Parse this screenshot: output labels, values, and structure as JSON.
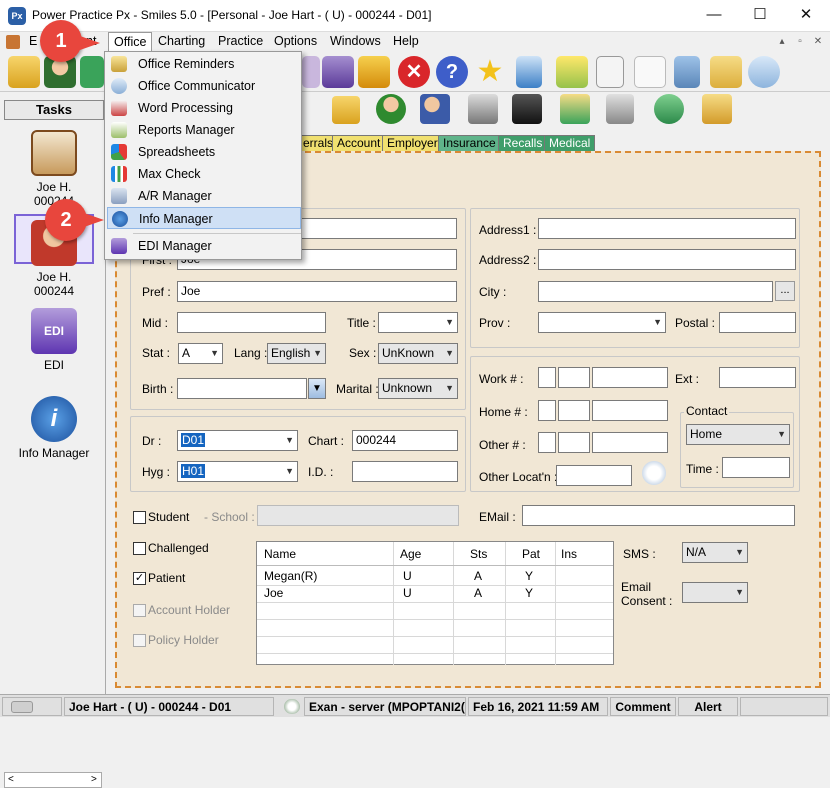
{
  "window": {
    "title": "Power Practice Px - Smiles 5.0 - [Personal - Joe Hart - ( U) - 000244 - D01]",
    "logo_text": "Px",
    "minimize": "—",
    "maximize": "☐",
    "close": "✕"
  },
  "menubar": {
    "partial_label": "E",
    "partial_label_end": "nt",
    "items": [
      "Office",
      "Charting",
      "Practice",
      "Options",
      "Windows",
      "Help"
    ],
    "mdi_controls": [
      "▴",
      "▫",
      "✕"
    ]
  },
  "office_menu": {
    "items": [
      {
        "label": "Office Reminders",
        "icon": "reminders-icon"
      },
      {
        "label": "Office Communicator",
        "icon": "communicator-icon"
      },
      {
        "label": "Word Processing",
        "icon": "word-processing-icon"
      },
      {
        "label": "Reports Manager",
        "icon": "reports-icon"
      },
      {
        "label": "Spreadsheets",
        "icon": "spreadsheet-icon"
      },
      {
        "label": "Max Check",
        "icon": "max-check-icon"
      },
      {
        "label": "A/R Manager",
        "icon": "ar-manager-icon"
      },
      {
        "label": "Info Manager",
        "icon": "info-icon"
      },
      {
        "label": "EDI Manager",
        "icon": "edi-icon"
      }
    ],
    "highlighted": "Info Manager"
  },
  "callouts": [
    "1",
    "2"
  ],
  "tasks": {
    "header": "Tasks",
    "items": [
      {
        "line1": "Joe H.",
        "line2": "000244"
      },
      {
        "line1": "Joe H.",
        "line2": "000244"
      },
      {
        "line1": "EDI",
        "line2": ""
      },
      {
        "line1": "Info Manager",
        "line2": ""
      }
    ],
    "scroll_left": "<",
    "scroll_right": ">"
  },
  "tabs": [
    {
      "label": "errals",
      "color": "#f0e070"
    },
    {
      "label": "Account",
      "color": "#f0e070"
    },
    {
      "label": "Employer",
      "color": "#f0e070"
    },
    {
      "label": "Insurance",
      "color": "#5fb48a"
    },
    {
      "label": "Recalls",
      "color": "#3f9e6a"
    },
    {
      "label": "Medical",
      "color": "#3f9e6a"
    }
  ],
  "form": {
    "first_label": "First :",
    "first_value": "Joe",
    "pref_label": "Pref :",
    "pref_value": "Joe",
    "mid_label": "Mid :",
    "mid_value": "",
    "title_label": "Title :",
    "title_value": "",
    "stat_label": "Stat :",
    "stat_value": "A",
    "lang_label": "Lang :",
    "lang_value": "English",
    "sex_label": "Sex :",
    "sex_value": "UnKnown",
    "birth_label": "Birth :",
    "birth_value": "",
    "marital_label": "Marital :",
    "marital_value": "Unknown",
    "dr_label": "Dr :",
    "dr_value": "D01",
    "chart_label": "Chart :",
    "chart_value": "000244",
    "hyg_label": "Hyg :",
    "hyg_value": "H01",
    "id_label": "I.D. :",
    "id_value": "",
    "address1_label": "Address1 :",
    "address2_label": "Address2 :",
    "city_label": "City :",
    "city_button": "...",
    "prov_label": "Prov :",
    "postal_label": "Postal :",
    "work_label": "Work # :",
    "ext_label": "Ext :",
    "home_label": "Home # :",
    "contact_label": "Contact",
    "contact_value": "Home",
    "other_label": "Other # :",
    "time_label": "Time :",
    "other_locat_label": "Other Locat'n :",
    "student_label": "Student",
    "school_label": "- School :",
    "email_label": "EMail :",
    "challenged_label": "Challenged",
    "patient_label": "Patient",
    "patient_checked": "✓",
    "account_holder_label": "Account Holder",
    "policy_holder_label": "Policy Holder",
    "sms_label": "SMS :",
    "sms_value": "N/A",
    "email_consent_label1": "Email",
    "email_consent_label2": "Consent :",
    "email_consent_value": ""
  },
  "family_table": {
    "headers": [
      "Name",
      "Age",
      "Sts",
      "Pat",
      "Ins"
    ],
    "rows": [
      [
        "Megan(R)",
        "U",
        "A",
        "Y",
        ""
      ],
      [
        "Joe",
        "U",
        "A",
        "Y",
        ""
      ]
    ]
  },
  "statusbar": {
    "patient": "Joe Hart - ( U) - 000244 - D01",
    "server": "Exan - server (MPOPTANI2(",
    "datetime": "Feb 16, 2021 11:59 AM",
    "comment": "Comment",
    "alert": "Alert"
  }
}
